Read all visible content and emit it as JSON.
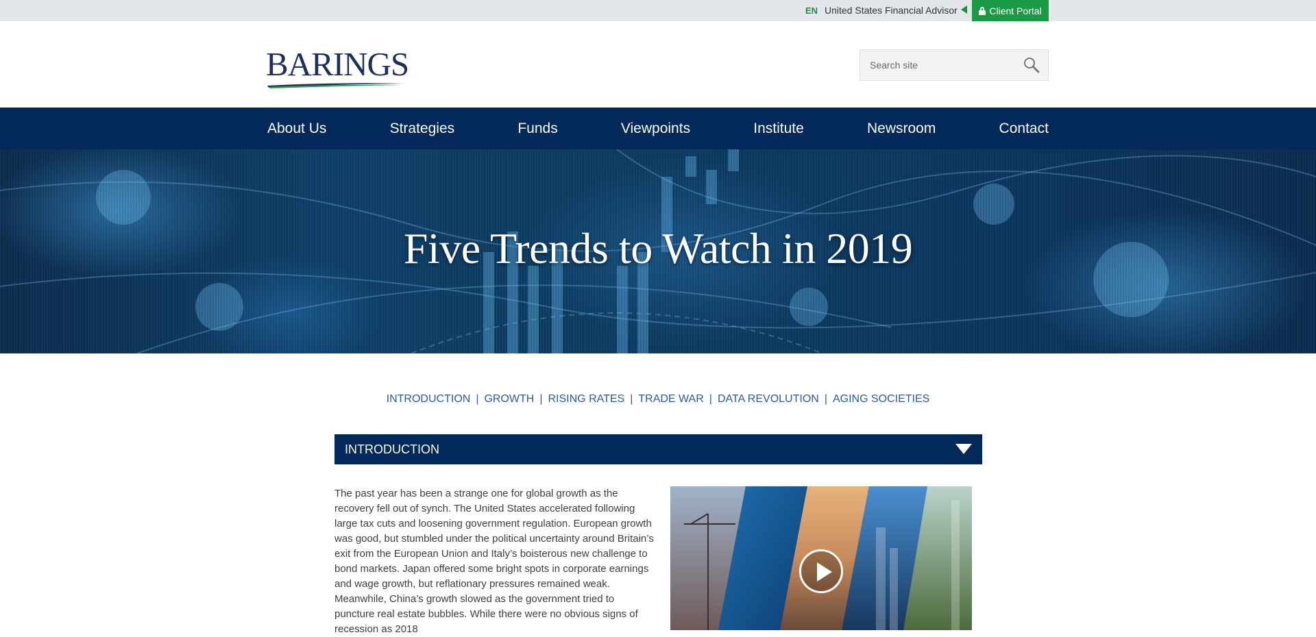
{
  "topbar": {
    "language": "EN",
    "region": "United States Financial Advisor",
    "client_portal": "Client Portal"
  },
  "brand": {
    "name": "BARINGS",
    "primary_color": "#03285a",
    "accent_color": "#1a9a44"
  },
  "search": {
    "placeholder": "Search site",
    "icon": "magnifier-icon"
  },
  "nav": {
    "items": [
      "About Us",
      "Strategies",
      "Funds",
      "Viewpoints",
      "Institute",
      "Newsroom",
      "Contact"
    ]
  },
  "hero": {
    "title": "Five Trends to Watch in 2019"
  },
  "subnav": {
    "items": [
      "INTRODUCTION",
      "GROWTH",
      "RISING RATES",
      "TRADE WAR",
      "DATA REVOLUTION",
      "AGING SOCIETIES"
    ]
  },
  "section": {
    "title": "INTRODUCTION",
    "toggle_icon": "triangle-down-icon",
    "body": "The past year has been a strange one for global growth as the recovery fell out of synch. The United States accelerated following large tax cuts and loosening government regulation. European growth was good, but stumbled under the political uncertainty around Britain’s exit from the European Union and Italy’s boisterous new challenge to bond markets. Japan offered some bright spots in corporate earnings and wage growth, but reflationary pressures remained weak. Meanwhile, China’s growth slowed as the government tried to puncture real estate bubbles. While there were no obvious signs of recession as 2018"
  },
  "video": {
    "icon": "play-icon"
  }
}
